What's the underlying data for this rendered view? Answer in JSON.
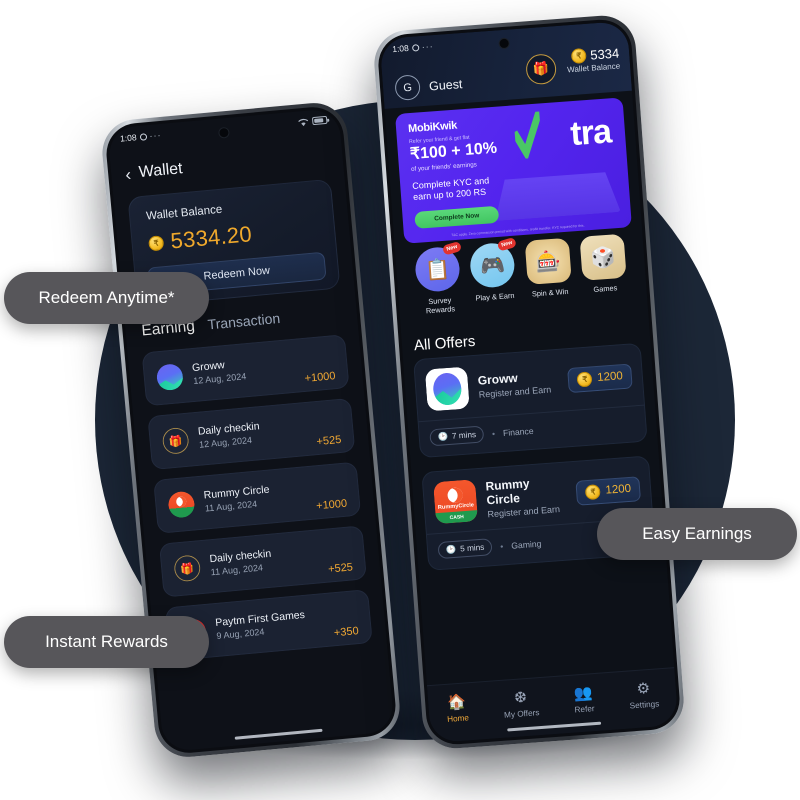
{
  "callouts": [
    {
      "id": "redeem",
      "label": "Redeem Anytime*"
    },
    {
      "id": "instant",
      "label": "Instant Rewards"
    },
    {
      "id": "easy",
      "label": "Easy Earnings"
    }
  ],
  "wallet_phone": {
    "status_bar": {
      "time": "1:08",
      "menu_dots": "···"
    },
    "header": {
      "back_icon": "‹",
      "title": "Wallet"
    },
    "balance_card": {
      "label": "Wallet Balance",
      "coin_symbol": "₹",
      "amount": "5334.20",
      "redeem_label": "Redeem Now"
    },
    "tabs": [
      {
        "label": "Earning",
        "active": true
      },
      {
        "label": "Transaction",
        "active": false
      }
    ],
    "earnings": [
      {
        "icon": "groww-icon",
        "name": "Groww",
        "date": "12 Aug, 2024",
        "amount": "+1000"
      },
      {
        "icon": "gift-icon",
        "name": "Daily checkin",
        "date": "12 Aug, 2024",
        "amount": "+525"
      },
      {
        "icon": "rummy-circle-icon",
        "name": "Rummy Circle",
        "date": "11 Aug, 2024",
        "amount": "+1000"
      },
      {
        "icon": "gift-icon",
        "name": "Daily checkin",
        "date": "11 Aug, 2024",
        "amount": "+525"
      },
      {
        "icon": "paytm-first-games-icon",
        "name": "Paytm First Games",
        "date": "9 Aug, 2024",
        "amount": "+350"
      }
    ]
  },
  "home_phone": {
    "status_bar": {
      "time": "1:08",
      "menu_dots": "···"
    },
    "top_bar": {
      "gift_icon": "🎁",
      "wallet_amount": "5334",
      "wallet_label": "Wallet Balance",
      "avatar_initial": "G",
      "user_name": "Guest"
    },
    "banner": {
      "brand": "MobiKwik",
      "refer_line": "Refer your friend & get flat",
      "headline": "₹100 + 10%",
      "headline_sub": "of your friends' earnings",
      "kyc_line": "Complete KYC and\nearn up to 200 RS",
      "cta": "Complete Now",
      "xtra_text": "tra",
      "fine_print": "T&C apply. Zero commission period with conditions, credit transfer, KYC required for this."
    },
    "quick_apps": [
      {
        "label": "Survey\nRewards",
        "badge": "New",
        "icon": "survey-icon"
      },
      {
        "label": "Play & Earn",
        "badge": "New",
        "icon": "gamepad-icon"
      },
      {
        "label": "Spin & Win",
        "badge": "",
        "icon": "spin-wheel-icon"
      },
      {
        "label": "Games",
        "badge": "",
        "icon": "games-board-icon"
      }
    ],
    "offers_title": "All Offers",
    "offers": [
      {
        "logo": "groww-logo",
        "name": "Groww",
        "desc": "Register and Earn",
        "coins": "1200",
        "time": "7 mins",
        "category": "Finance"
      },
      {
        "logo": "rummy-circle-logo",
        "name": "Rummy Circle",
        "desc": "Register and Earn",
        "coins": "1200",
        "time": "5 mins",
        "category": "Gaming"
      }
    ],
    "bottom_nav": [
      {
        "label": "Home",
        "icon": "home-icon",
        "active": true
      },
      {
        "label": "My Offers",
        "icon": "offers-icon",
        "active": false
      },
      {
        "label": "Refer",
        "icon": "refer-icon",
        "active": false
      },
      {
        "label": "Settings",
        "icon": "gear-icon",
        "active": false
      }
    ]
  },
  "colors": {
    "accent_orange": "#f0a93a",
    "banner_purple": "#5425ef",
    "xtra_green": "#4ac765",
    "background_circle": "#1c2737",
    "pill_gray": "#57565a"
  }
}
